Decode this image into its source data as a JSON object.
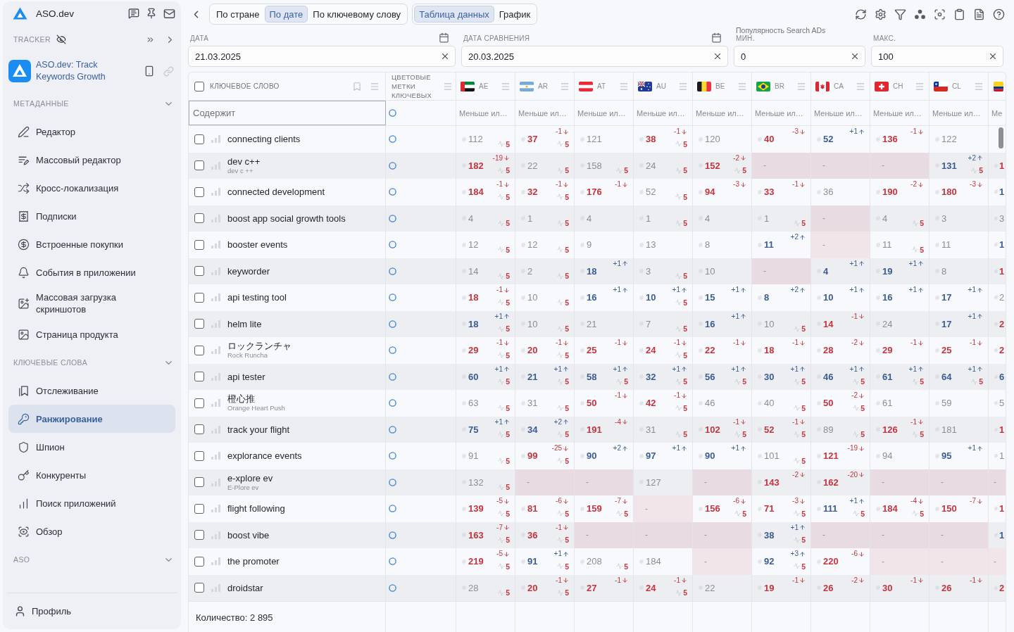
{
  "sidebar": {
    "brand": "ASO.dev",
    "tracker_label": "TRACKER",
    "app_name": "ASO.dev: Track Keywords Growth",
    "sections": [
      {
        "title": "МЕТАДАННЫЕ",
        "expanded": true,
        "items": [
          {
            "label": "Редактор",
            "selected": false
          },
          {
            "label": "Массовый редактор",
            "selected": false
          },
          {
            "label": "Кросс-локализация",
            "selected": false
          },
          {
            "label": "Подписки",
            "selected": false
          },
          {
            "label": "Встроенные покупки",
            "selected": false
          },
          {
            "label": "События в приложении",
            "selected": false
          },
          {
            "label": "Массовая загрузка скриншотов",
            "selected": false
          },
          {
            "label": "Страница продукта",
            "selected": false
          }
        ]
      },
      {
        "title": "КЛЮЧЕВЫЕ СЛОВА",
        "expanded": true,
        "items": [
          {
            "label": "Отслеживание",
            "selected": false
          },
          {
            "label": "Ранжирование",
            "selected": true
          },
          {
            "label": "Шпион",
            "selected": false
          },
          {
            "label": "Конкуренты",
            "selected": false
          },
          {
            "label": "Поиск приложений",
            "selected": false
          },
          {
            "label": "Обзор",
            "selected": false
          }
        ]
      },
      {
        "title": "ASO",
        "expanded": true
      }
    ],
    "profile": "Профиль"
  },
  "toolbar": {
    "view_modes": [
      {
        "label": "По стране",
        "selected": false
      },
      {
        "label": "По дате",
        "selected": true
      },
      {
        "label": "По ключевому слову",
        "selected": false
      }
    ],
    "display_modes": [
      {
        "label": "Таблица данных",
        "selected": true
      },
      {
        "label": "График",
        "selected": false
      }
    ]
  },
  "filters": {
    "date": {
      "label": "ДАТА",
      "value": "21.03.2025"
    },
    "compare_date": {
      "label": "ДАТА СРАВНЕНИЯ",
      "value": "20.03.2025"
    },
    "popularity": {
      "title": "Популярность Search ADs",
      "min": {
        "label": "МИН.",
        "value": "0"
      },
      "max": {
        "label": "МАКС.",
        "value": "100"
      }
    }
  },
  "table": {
    "select_all_checked": false,
    "keyword_header": "КЛЮЧЕВОЕ СЛОВО",
    "color_header": "ЦВЕТОВЫЕ МЕТКИ КЛЮЧЕВЫХ",
    "keyword_filter_placeholder": "Содержит",
    "countries": [
      {
        "code": "AE",
        "filter_placeholder": "Меньше ил…"
      },
      {
        "code": "AR",
        "filter_placeholder": "Меньше ил…"
      },
      {
        "code": "AT",
        "filter_placeholder": "Меньше ил…"
      },
      {
        "code": "AU",
        "filter_placeholder": "Меньше ил…"
      },
      {
        "code": "BE",
        "filter_placeholder": "Меньше ил…"
      },
      {
        "code": "BR",
        "filter_placeholder": "Меньше ил…"
      },
      {
        "code": "CA",
        "filter_placeholder": "Меньше ил…"
      },
      {
        "code": "CH",
        "filter_placeholder": "Меньше ил…"
      },
      {
        "code": "CL",
        "filter_placeholder": "Меньше ил…"
      }
    ],
    "column_12": {
      "filter_placeholder": "Ме"
    },
    "rows": [
      {
        "keyword": "connecting clients",
        "checked": false,
        "cells": [
          {
            "kind": "steady",
            "rank": "112",
            "popularity": "5"
          },
          {
            "kind": "fall",
            "rank": "37",
            "change": "-1",
            "popularity": "5"
          },
          {
            "kind": "steady",
            "rank": "121"
          },
          {
            "kind": "fall",
            "rank": "38",
            "change": "-1",
            "popularity": "5"
          },
          {
            "kind": "steady",
            "rank": "120"
          },
          {
            "kind": "fall",
            "rank": "40",
            "change": "-3"
          },
          {
            "kind": "rise",
            "rank": "52",
            "change": "+1"
          },
          {
            "kind": "fall",
            "rank": "136",
            "change": "-1"
          },
          {
            "kind": "steady",
            "rank": "122"
          }
        ]
      },
      {
        "keyword": "dev c++",
        "sub": "dev c ++",
        "checked": false,
        "cells": [
          {
            "kind": "fall",
            "rank": "182",
            "change": "-19",
            "popularity": "5"
          },
          {
            "kind": "steady",
            "rank": "22",
            "popularity": "5"
          },
          {
            "kind": "steady",
            "rank": "158",
            "popularity": "5"
          },
          {
            "kind": "steady",
            "rank": "24",
            "popularity": "5"
          },
          {
            "kind": "fall",
            "rank": "152",
            "change": "-2",
            "popularity": "5"
          },
          {
            "kind": "missing",
            "rank": "-"
          },
          {
            "kind": "missing",
            "rank": "-"
          },
          {
            "kind": "missing",
            "rank": "-"
          },
          {
            "kind": "rise",
            "rank": "131",
            "change": "+2",
            "popularity": "5"
          }
        ],
        "column_12": {
          "kind": "fall",
          "rank": "1"
        }
      },
      {
        "keyword": "connected development",
        "checked": false,
        "cells": [
          {
            "kind": "fall",
            "rank": "184",
            "change": "-1",
            "popularity": "5"
          },
          {
            "kind": "fall",
            "rank": "32",
            "change": "-1",
            "popularity": "5"
          },
          {
            "kind": "fall",
            "rank": "176",
            "change": "-1"
          },
          {
            "kind": "steady",
            "rank": "52",
            "popularity": "5"
          },
          {
            "kind": "fall",
            "rank": "94",
            "change": "-3"
          },
          {
            "kind": "fall",
            "rank": "33",
            "change": "-1"
          },
          {
            "kind": "steady",
            "rank": "36"
          },
          {
            "kind": "fall",
            "rank": "190",
            "change": "-2"
          },
          {
            "kind": "fall",
            "rank": "180",
            "change": "-3"
          }
        ],
        "column_12": {
          "kind": "rise",
          "rank": "1"
        }
      },
      {
        "keyword": "boost app social growth tools",
        "checked": false,
        "cells": [
          {
            "kind": "steady",
            "rank": "4",
            "popularity": "5"
          },
          {
            "kind": "steady",
            "rank": "1",
            "popularity": "5"
          },
          {
            "kind": "steady",
            "rank": "4"
          },
          {
            "kind": "steady",
            "rank": "1",
            "popularity": "5"
          },
          {
            "kind": "steady",
            "rank": "4"
          },
          {
            "kind": "steady",
            "rank": "1",
            "popularity": "5"
          },
          {
            "kind": "missing",
            "rank": "-"
          },
          {
            "kind": "steady",
            "rank": "4",
            "popularity": "5"
          },
          {
            "kind": "steady",
            "rank": "3"
          }
        ],
        "column_12": {
          "kind": "steady",
          "rank": "3"
        }
      },
      {
        "keyword": "booster events",
        "checked": false,
        "cells": [
          {
            "kind": "steady",
            "rank": "12",
            "popularity": "5"
          },
          {
            "kind": "steady",
            "rank": "12",
            "popularity": "5"
          },
          {
            "kind": "steady",
            "rank": "9"
          },
          {
            "kind": "steady",
            "rank": "13"
          },
          {
            "kind": "steady",
            "rank": "8"
          },
          {
            "kind": "rise",
            "rank": "11",
            "change": "+2"
          },
          {
            "kind": "missing",
            "rank": "-"
          },
          {
            "kind": "steady",
            "rank": "11",
            "popularity": "5"
          },
          {
            "kind": "steady",
            "rank": "11"
          }
        ],
        "column_12": {
          "kind": "rise",
          "rank": "1"
        }
      },
      {
        "keyword": "keyworder",
        "checked": false,
        "cells": [
          {
            "kind": "steady",
            "rank": "14",
            "popularity": "5"
          },
          {
            "kind": "steady",
            "rank": "2",
            "popularity": "5"
          },
          {
            "kind": "rise",
            "rank": "18",
            "change": "+1"
          },
          {
            "kind": "steady",
            "rank": "3",
            "popularity": "5"
          },
          {
            "kind": "steady",
            "rank": "10"
          },
          {
            "kind": "missing",
            "rank": "-"
          },
          {
            "kind": "rise",
            "rank": "4",
            "change": "+1"
          },
          {
            "kind": "rise",
            "rank": "19",
            "change": "+1"
          },
          {
            "kind": "steady",
            "rank": "8"
          }
        ],
        "column_12": {
          "kind": "fall",
          "rank": "1"
        }
      },
      {
        "keyword": "api testing tool",
        "checked": false,
        "cells": [
          {
            "kind": "fall",
            "rank": "18",
            "change": "-1",
            "popularity": "5"
          },
          {
            "kind": "steady",
            "rank": "10",
            "popularity": "5"
          },
          {
            "kind": "rise",
            "rank": "16",
            "change": "+1"
          },
          {
            "kind": "rise",
            "rank": "10",
            "change": "+1",
            "popularity": "5"
          },
          {
            "kind": "rise",
            "rank": "15",
            "change": "+1"
          },
          {
            "kind": "rise",
            "rank": "8",
            "change": "+2"
          },
          {
            "kind": "rise",
            "rank": "10",
            "change": "+1"
          },
          {
            "kind": "rise",
            "rank": "16",
            "change": "+1"
          },
          {
            "kind": "rise",
            "rank": "17",
            "change": "+1"
          }
        ],
        "column_12": {
          "kind": "steady",
          "rank": "2"
        }
      },
      {
        "keyword": "helm lite",
        "checked": false,
        "cells": [
          {
            "kind": "rise",
            "rank": "18",
            "change": "+1",
            "popularity": "5"
          },
          {
            "kind": "steady",
            "rank": "10",
            "popularity": "5"
          },
          {
            "kind": "steady",
            "rank": "21"
          },
          {
            "kind": "steady",
            "rank": "7",
            "popularity": "5"
          },
          {
            "kind": "rise",
            "rank": "16",
            "change": "+1"
          },
          {
            "kind": "steady",
            "rank": "10",
            "popularity": "5"
          },
          {
            "kind": "fall",
            "rank": "14",
            "change": "-1"
          },
          {
            "kind": "steady",
            "rank": "24"
          },
          {
            "kind": "rise",
            "rank": "17",
            "change": "+1"
          }
        ],
        "column_12": {
          "kind": "fall",
          "rank": "2"
        }
      },
      {
        "keyword": "ロックランチャ",
        "sub": "Rock Runcha",
        "checked": false,
        "cells": [
          {
            "kind": "fall",
            "rank": "29",
            "change": "-1",
            "popularity": "5"
          },
          {
            "kind": "fall",
            "rank": "20",
            "change": "-1",
            "popularity": "5"
          },
          {
            "kind": "fall",
            "rank": "25",
            "change": "-1"
          },
          {
            "kind": "fall",
            "rank": "24",
            "change": "-1",
            "popularity": "5"
          },
          {
            "kind": "fall",
            "rank": "22",
            "change": "-1"
          },
          {
            "kind": "fall",
            "rank": "18",
            "change": "-1"
          },
          {
            "kind": "fall",
            "rank": "28",
            "change": "-2"
          },
          {
            "kind": "fall",
            "rank": "29",
            "change": "-1"
          },
          {
            "kind": "fall",
            "rank": "25",
            "change": "-1"
          }
        ],
        "column_12": {
          "kind": "fall",
          "rank": "2"
        }
      },
      {
        "keyword": "api tester",
        "checked": false,
        "cells": [
          {
            "kind": "rise",
            "rank": "60",
            "change": "+1",
            "popularity": "5"
          },
          {
            "kind": "rise",
            "rank": "21",
            "change": "+1",
            "popularity": "5"
          },
          {
            "kind": "rise",
            "rank": "58",
            "change": "+1",
            "popularity": "5"
          },
          {
            "kind": "rise",
            "rank": "32",
            "change": "+1",
            "popularity": "5"
          },
          {
            "kind": "rise",
            "rank": "56",
            "change": "+1",
            "popularity": "5"
          },
          {
            "kind": "rise",
            "rank": "30",
            "change": "+1",
            "popularity": "5"
          },
          {
            "kind": "rise",
            "rank": "46",
            "change": "+1",
            "popularity": "5"
          },
          {
            "kind": "rise",
            "rank": "61",
            "change": "+1",
            "popularity": "5"
          },
          {
            "kind": "rise",
            "rank": "64",
            "change": "+1",
            "popularity": "5"
          }
        ],
        "column_12": {
          "kind": "rise",
          "rank": "6"
        }
      },
      {
        "keyword": "橙心推",
        "sub": "Orange Heart Push",
        "checked": false,
        "cells": [
          {
            "kind": "steady",
            "rank": "63",
            "popularity": "5"
          },
          {
            "kind": "steady",
            "rank": "31",
            "popularity": "5"
          },
          {
            "kind": "fall",
            "rank": "50",
            "change": "-1"
          },
          {
            "kind": "fall",
            "rank": "42",
            "change": "-1",
            "popularity": "5"
          },
          {
            "kind": "steady",
            "rank": "46"
          },
          {
            "kind": "steady",
            "rank": "40",
            "popularity": "5"
          },
          {
            "kind": "fall",
            "rank": "50",
            "change": "-2",
            "popularity": "5"
          },
          {
            "kind": "steady",
            "rank": "61"
          },
          {
            "kind": "steady",
            "rank": "59"
          }
        ],
        "column_12": {
          "kind": "steady",
          "rank": "5"
        }
      },
      {
        "keyword": "track your flight",
        "checked": false,
        "cells": [
          {
            "kind": "rise",
            "rank": "75",
            "change": "+1",
            "popularity": "5"
          },
          {
            "kind": "rise",
            "rank": "34",
            "change": "+2",
            "popularity": "5"
          },
          {
            "kind": "fall",
            "rank": "191",
            "change": "-4"
          },
          {
            "kind": "steady",
            "rank": "31",
            "popularity": "5"
          },
          {
            "kind": "fall",
            "rank": "102",
            "change": "-1",
            "popularity": "5"
          },
          {
            "kind": "fall",
            "rank": "52",
            "change": "-1",
            "popularity": "5"
          },
          {
            "kind": "steady",
            "rank": "89",
            "popularity": "5"
          },
          {
            "kind": "fall",
            "rank": "126",
            "change": "-1",
            "popularity": "5"
          },
          {
            "kind": "steady",
            "rank": "181"
          }
        ],
        "column_12": {
          "kind": "fall",
          "rank": "1"
        }
      },
      {
        "keyword": "explorance events",
        "checked": false,
        "cells": [
          {
            "kind": "steady",
            "rank": "91",
            "popularity": "5"
          },
          {
            "kind": "fall",
            "rank": "99",
            "change": "-25",
            "popularity": "5"
          },
          {
            "kind": "rise",
            "rank": "90",
            "change": "+2"
          },
          {
            "kind": "rise",
            "rank": "97",
            "change": "+1"
          },
          {
            "kind": "rise",
            "rank": "90",
            "change": "+1"
          },
          {
            "kind": "steady",
            "rank": "101",
            "popularity": "5"
          },
          {
            "kind": "fall",
            "rank": "121",
            "change": "-19"
          },
          {
            "kind": "steady",
            "rank": "94"
          },
          {
            "kind": "rise",
            "rank": "95",
            "change": "+1"
          }
        ],
        "column_12": {
          "kind": "steady",
          "rank": "1"
        }
      },
      {
        "keyword": "e-xplore ev",
        "sub": "E-Plore ev",
        "checked": false,
        "cells": [
          {
            "kind": "steady",
            "rank": "132",
            "popularity": "5"
          },
          {
            "kind": "missing",
            "rank": "-"
          },
          {
            "kind": "missing",
            "rank": "-"
          },
          {
            "kind": "steady",
            "rank": "127"
          },
          {
            "kind": "missing",
            "rank": "-"
          },
          {
            "kind": "fall",
            "rank": "143",
            "change": "-2"
          },
          {
            "kind": "fall",
            "rank": "162",
            "change": "-20"
          },
          {
            "kind": "missing",
            "rank": "-"
          },
          {
            "kind": "missing",
            "rank": "-"
          }
        ],
        "column_12": {
          "kind": "missing",
          "rank": "-"
        }
      },
      {
        "keyword": "flight following",
        "checked": false,
        "cells": [
          {
            "kind": "fall",
            "rank": "139",
            "change": "-5",
            "popularity": "5"
          },
          {
            "kind": "fall",
            "rank": "81",
            "change": "-6",
            "popularity": "5"
          },
          {
            "kind": "fall",
            "rank": "159",
            "change": "-7",
            "popularity": "5"
          },
          {
            "kind": "missing",
            "rank": "-"
          },
          {
            "kind": "fall",
            "rank": "156",
            "change": "-6",
            "popularity": "5"
          },
          {
            "kind": "fall",
            "rank": "71",
            "change": "-3",
            "popularity": "5"
          },
          {
            "kind": "rise",
            "rank": "111",
            "change": "+1",
            "popularity": "5"
          },
          {
            "kind": "fall",
            "rank": "184",
            "change": "-4",
            "popularity": "5"
          },
          {
            "kind": "fall",
            "rank": "150",
            "change": "-7"
          }
        ],
        "column_12": {
          "kind": "fall",
          "rank": "1"
        }
      },
      {
        "keyword": "boost vibe",
        "checked": false,
        "cells": [
          {
            "kind": "fall",
            "rank": "163",
            "change": "-7",
            "popularity": "5"
          },
          {
            "kind": "fall",
            "rank": "36",
            "change": "-1",
            "popularity": "5"
          },
          {
            "kind": "missing",
            "rank": "-"
          },
          {
            "kind": "missing",
            "rank": "-"
          },
          {
            "kind": "missing",
            "rank": "-"
          },
          {
            "kind": "rise",
            "rank": "38",
            "change": "+1",
            "popularity": "5"
          },
          {
            "kind": "missing",
            "rank": "-"
          },
          {
            "kind": "missing",
            "rank": "-"
          },
          {
            "kind": "missing",
            "rank": "-"
          }
        ],
        "column_12": {
          "kind": "rise",
          "rank": "1"
        }
      },
      {
        "keyword": "the promoter",
        "checked": false,
        "cells": [
          {
            "kind": "fall",
            "rank": "219",
            "change": "-5",
            "popularity": "5"
          },
          {
            "kind": "rise",
            "rank": "91",
            "change": "+1",
            "popularity": "5"
          },
          {
            "kind": "steady",
            "rank": "208",
            "popularity": "5"
          },
          {
            "kind": "steady",
            "rank": "184"
          },
          {
            "kind": "missing",
            "rank": "-"
          },
          {
            "kind": "rise",
            "rank": "92",
            "change": "+3",
            "popularity": "5"
          },
          {
            "kind": "fall",
            "rank": "220",
            "change": "-6"
          },
          {
            "kind": "missing",
            "rank": "-"
          },
          {
            "kind": "missing",
            "rank": "-"
          }
        ],
        "column_12": {
          "kind": "missing",
          "rank": "-"
        }
      },
      {
        "keyword": "droidstar",
        "checked": false,
        "cells": [
          {
            "kind": "steady",
            "rank": "28",
            "popularity": "5"
          },
          {
            "kind": "fall",
            "rank": "20",
            "change": "-1",
            "popularity": "5"
          },
          {
            "kind": "fall",
            "rank": "27",
            "change": "-1"
          },
          {
            "kind": "fall",
            "rank": "24",
            "change": "-1",
            "popularity": "5"
          },
          {
            "kind": "steady",
            "rank": "22"
          },
          {
            "kind": "fall",
            "rank": "19",
            "change": "-1"
          },
          {
            "kind": "fall",
            "rank": "26",
            "change": "-2"
          },
          {
            "kind": "fall",
            "rank": "30",
            "change": "-1"
          },
          {
            "kind": "fall",
            "rank": "26",
            "change": "-1"
          }
        ],
        "column_12": {
          "kind": "fall",
          "rank": "2"
        }
      }
    ],
    "footer_count": "Количество: 2 895"
  }
}
